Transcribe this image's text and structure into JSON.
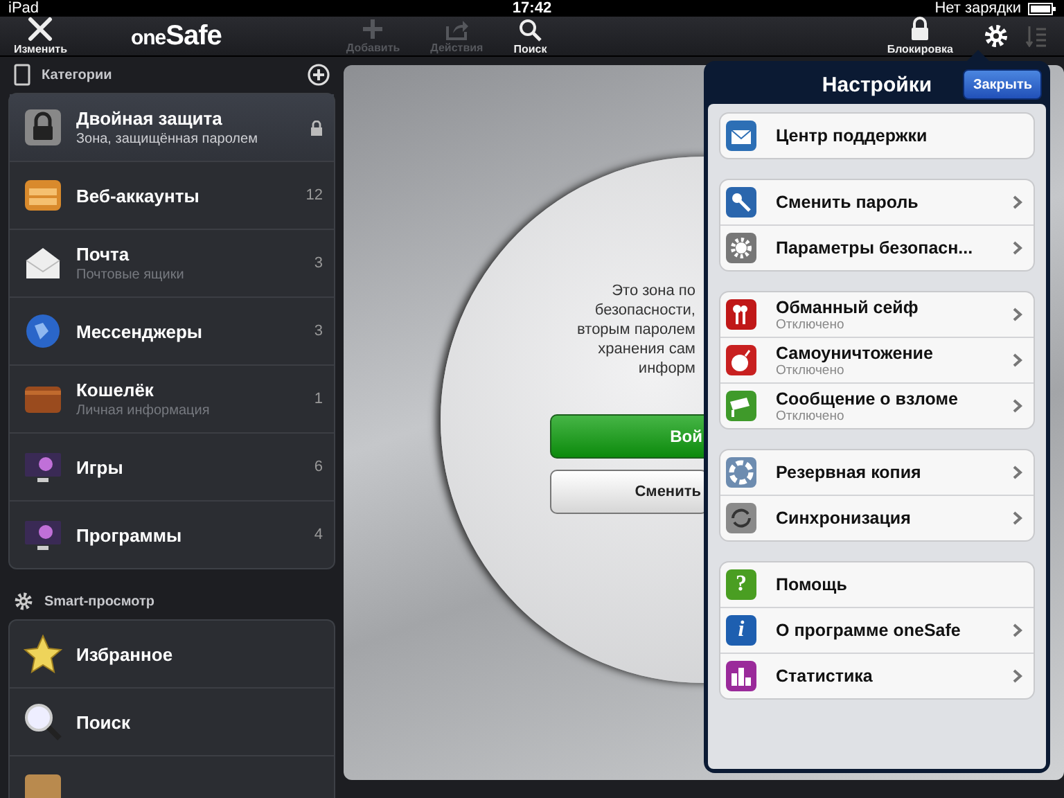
{
  "status_bar": {
    "device": "iPad",
    "time": "17:42",
    "battery_text": "Нет зарядки"
  },
  "toolbar": {
    "left": [
      {
        "label": "Изменить",
        "disabled": false
      }
    ],
    "logo": {
      "small": "one",
      "big": "Safe"
    },
    "center": [
      {
        "label": "Добавить",
        "disabled": true
      },
      {
        "label": "Действия",
        "disabled": true
      },
      {
        "label": "Поиск",
        "disabled": false
      }
    ],
    "right": [
      {
        "label": "Блокировка",
        "disabled": false
      }
    ]
  },
  "sidebar": {
    "categories_title": "Категории",
    "categories": [
      {
        "title": "Двойная защита",
        "subtitle": "Зона, защищённая паролем",
        "locked": true,
        "selected": true
      },
      {
        "title": "Веб-аккаунты",
        "count": "12",
        "locked": false,
        "selected": false
      },
      {
        "title": "Почта",
        "subtitle": "Почтовые ящики",
        "count": "3",
        "locked": false,
        "selected": false
      },
      {
        "title": "Мессенджеры",
        "count": "3",
        "locked": false,
        "selected": false
      },
      {
        "title": "Кошелёк",
        "subtitle": "Личная информация",
        "count": "1",
        "locked": false,
        "selected": false
      },
      {
        "title": "Игры",
        "count": "6",
        "locked": false,
        "selected": false
      },
      {
        "title": "Программы",
        "count": "4",
        "locked": false,
        "selected": false
      }
    ],
    "smart_title": "Smart-просмотр",
    "smart": [
      {
        "title": "Избранное",
        "selected": false
      },
      {
        "title": "Поиск",
        "selected": false
      }
    ]
  },
  "main": {
    "message_lines": [
      "Это зона по",
      "безопасности,",
      "вторым паролем",
      "хранения сам",
      "информ"
    ],
    "enter_button": "Вой",
    "change_button": "Сменить"
  },
  "settings": {
    "title": "Настройки",
    "close_button": "Закрыть",
    "groups": [
      [
        {
          "title": "Центр поддержки",
          "chevron": false
        }
      ],
      [
        {
          "title": "Сменить пароль",
          "chevron": true
        },
        {
          "title": "Параметры безопасн...",
          "chevron": true
        }
      ],
      [
        {
          "title": "Обманный сейф",
          "subtitle": "Отключено",
          "chevron": true
        },
        {
          "title": "Самоуничтожение",
          "subtitle": "Отключено",
          "chevron": true
        },
        {
          "title": "Сообщение о взломе",
          "subtitle": "Отключено",
          "chevron": true
        }
      ],
      [
        {
          "title": "Резервная копия",
          "chevron": true
        },
        {
          "title": "Синхронизация",
          "chevron": true
        }
      ],
      [
        {
          "title": "Помощь",
          "glyph": "?",
          "chevron": false
        },
        {
          "title": "О программе oneSafe",
          "glyph": "i",
          "chevron": true
        },
        {
          "title": "Статистика",
          "chevron": true
        }
      ]
    ]
  }
}
